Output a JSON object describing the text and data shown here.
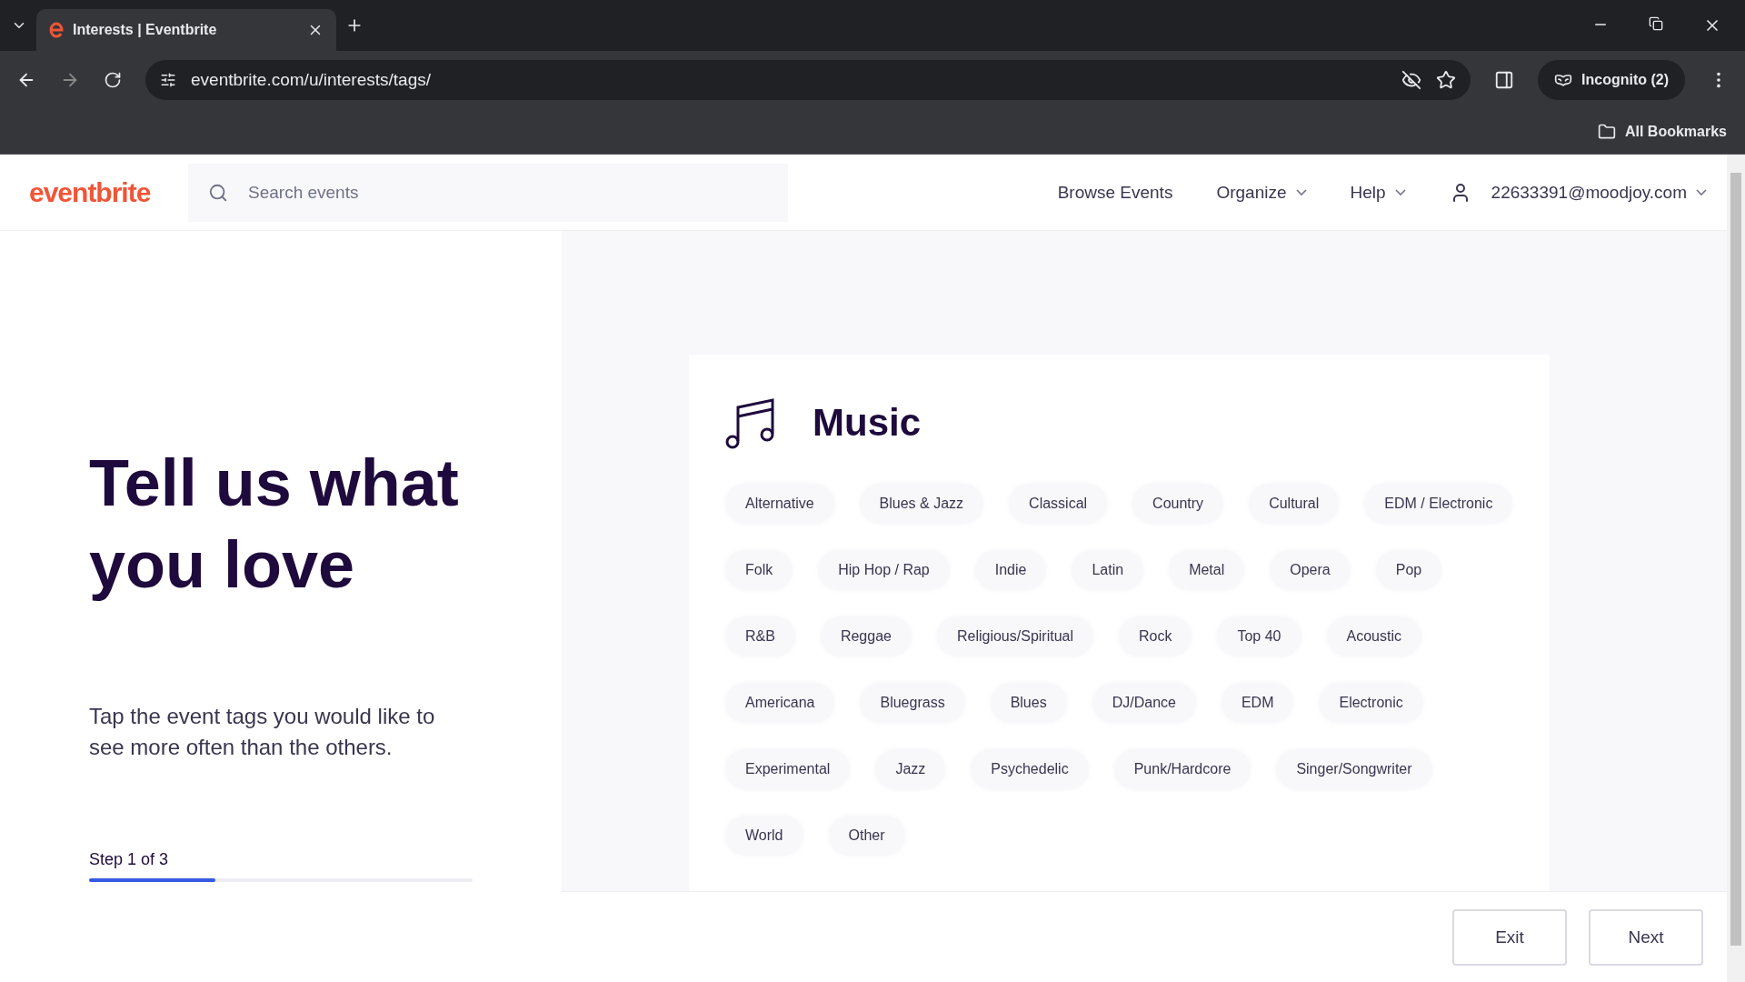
{
  "browser": {
    "tab_title": "Interests | Eventbrite",
    "url": "eventbrite.com/u/interests/tags/",
    "profile": "Incognito (2)",
    "bookmarks": "All Bookmarks"
  },
  "header": {
    "logo": "eventbrite",
    "search": {
      "placeholder": "Search events"
    },
    "nav": [
      "Browse Events",
      "Organize",
      "Help"
    ],
    "account": "22633391@moodjoy.com"
  },
  "intro": {
    "title": "Tell us what you love",
    "text": "Tap the event tags you would like to see more often than the others.",
    "step": "Step 1 of 3",
    "level": 0.33
  },
  "category": {
    "title": "Music",
    "tags": [
      {
        "label": "Alternative",
        "selected": false
      },
      {
        "label": "Blues & Jazz",
        "selected": false
      },
      {
        "label": "Classical",
        "selected": false
      },
      {
        "label": "Country",
        "selected": false
      },
      {
        "label": "Cultural",
        "selected": false
      },
      {
        "label": "EDM / Electronic",
        "selected": false
      },
      {
        "label": "Folk",
        "selected": false
      },
      {
        "label": "Hip Hop / Rap",
        "selected": false
      },
      {
        "label": "Indie",
        "selected": false
      },
      {
        "label": "Latin",
        "selected": false
      },
      {
        "label": "Metal",
        "selected": false
      },
      {
        "label": "Opera",
        "selected": false
      },
      {
        "label": "Pop",
        "selected": false
      },
      {
        "label": "R&B",
        "selected": false
      },
      {
        "label": "Reggae",
        "selected": false
      },
      {
        "label": "Religious/Spiritual",
        "selected": false
      },
      {
        "label": "Rock",
        "selected": false
      },
      {
        "label": "Top 40",
        "selected": false
      },
      {
        "label": "Acoustic",
        "selected": false
      },
      {
        "label": "Americana",
        "selected": false
      },
      {
        "label": "Bluegrass",
        "selected": false
      },
      {
        "label": "Blues",
        "selected": false
      },
      {
        "label": "DJ/Dance",
        "selected": false
      },
      {
        "label": "EDM",
        "selected": false
      },
      {
        "label": "Electronic",
        "selected": false
      },
      {
        "label": "Experimental",
        "selected": false
      },
      {
        "label": "Jazz",
        "selected": false
      },
      {
        "label": "Psychedelic",
        "selected": false
      },
      {
        "label": "Punk/Hardcore",
        "selected": false
      },
      {
        "label": "Singer/Songwriter",
        "selected": false
      },
      {
        "label": "World",
        "selected": false
      },
      {
        "label": "Other",
        "selected": false
      }
    ]
  },
  "footer": {
    "buttons": [
      "Exit",
      "Next"
    ]
  }
}
